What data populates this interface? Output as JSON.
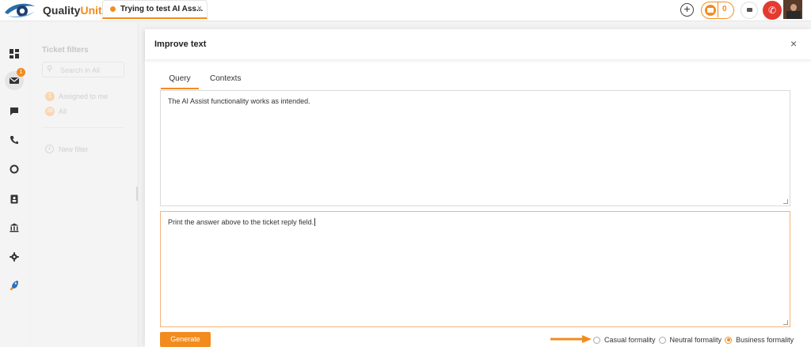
{
  "app": {
    "logo_prefix": "Quality",
    "logo_suffix": "Unit"
  },
  "tab": {
    "title": "Trying to test AI Ass...",
    "close": "×"
  },
  "topbar": {
    "plus": "+",
    "mail_count": "0",
    "phone_icon": "✆"
  },
  "nav": {
    "mail_badge": "1"
  },
  "filters": {
    "title": "Ticket filters",
    "search_icon": "⚲",
    "search_placeholder": "Search in All",
    "items": [
      {
        "badge": "1",
        "label": "Assigned to me"
      },
      {
        "badge": "26",
        "label": "All"
      }
    ],
    "new_filter_plus": "+",
    "new_filter": "New filter"
  },
  "modal": {
    "title": "Improve text",
    "close": "×",
    "tabs": [
      {
        "label": "Query"
      },
      {
        "label": "Contexts"
      }
    ],
    "top_text": "The AI Assist functionality works as intended.",
    "bottom_text": "Print the answer above to the ticket reply field.",
    "generate_label": "Generate",
    "formality_options": [
      {
        "label": "Casual formality",
        "selected": false
      },
      {
        "label": "Neutral formality",
        "selected": false
      },
      {
        "label": "Business formality",
        "selected": true
      }
    ]
  },
  "colors": {
    "accent": "#f28c1e",
    "danger": "#e43a2f"
  },
  "icons": {
    "nav": [
      "dashboard-icon",
      "mail-icon",
      "chat-icon",
      "phone-icon",
      "reports-icon",
      "contacts-icon",
      "bank-icon",
      "settings-icon",
      "rocket-icon"
    ]
  }
}
